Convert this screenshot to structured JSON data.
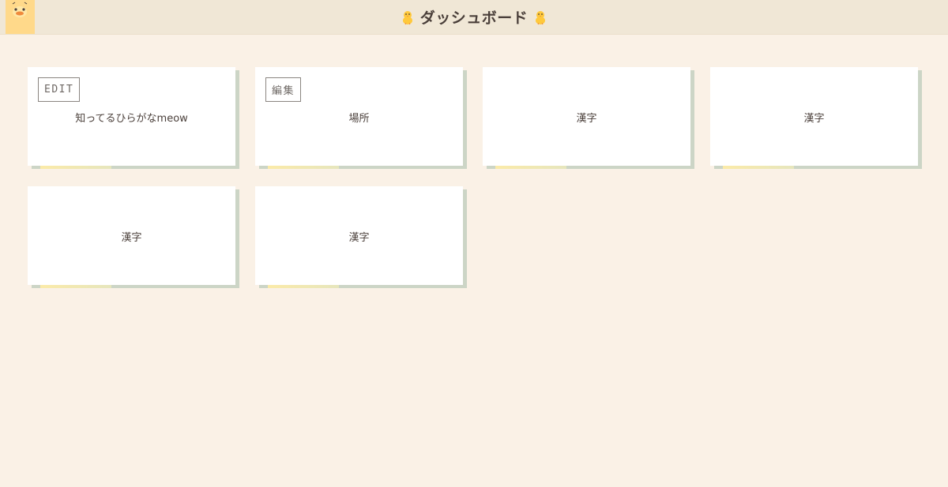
{
  "header": {
    "title": "ダッシュボード",
    "logo_icon": "duck-face-icon",
    "decor_icon": "baby-chick-icon"
  },
  "cards": [
    {
      "label": "知ってるひらがなmeow",
      "edit_label": "EDIT"
    },
    {
      "label": "場所",
      "edit_label": "編集"
    },
    {
      "label": "漢字"
    },
    {
      "label": "漢字"
    },
    {
      "label": "漢字"
    },
    {
      "label": "漢字"
    }
  ]
}
